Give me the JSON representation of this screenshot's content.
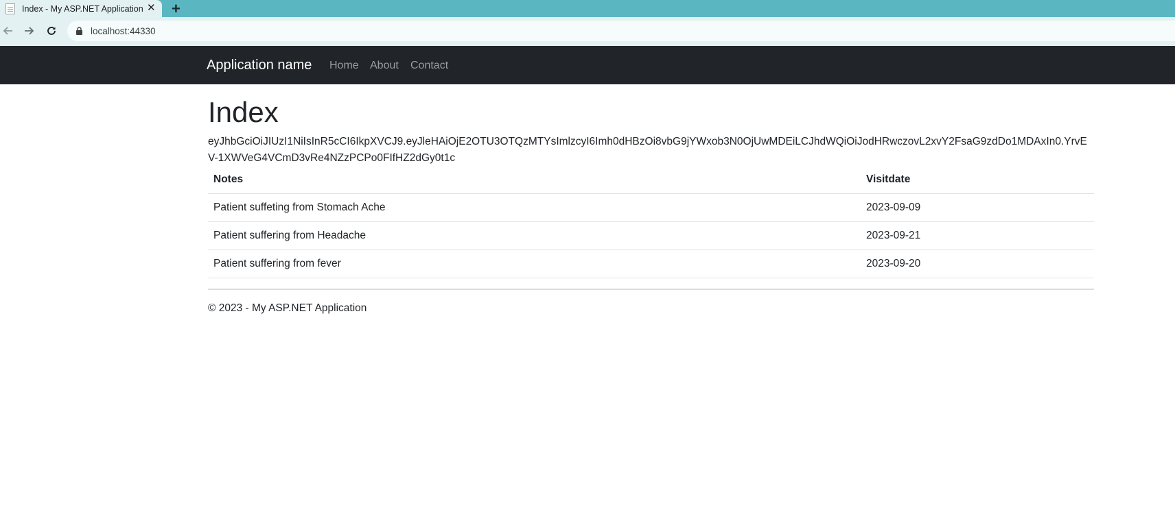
{
  "browser": {
    "tab_title": "Index - My ASP.NET Application",
    "tab_close": "✕",
    "new_tab": "+",
    "url": "localhost:44330"
  },
  "navbar": {
    "brand": "Application name",
    "links": [
      "Home",
      "About",
      "Contact"
    ]
  },
  "main": {
    "title": "Index",
    "token": "eyJhbGciOiJIUzI1NiIsInR5cCI6IkpXVCJ9.eyJleHAiOjE2OTU3OTQzMTYsImlzcyI6Imh0dHBzOi8vbG9jYWxob3N0OjUwMDEiLCJhdWQiOiJodHRwczovL2xvY2FsaG9zdDo1MDAxIn0.YrvEV-1XWVeG4VCmD3vRe4NZzPCPo0FIfHZ2dGy0t1c",
    "table": {
      "headers": [
        "Notes",
        "Visitdate"
      ],
      "rows": [
        [
          "Patient suffeting from Stomach Ache",
          "2023-09-09"
        ],
        [
          "Patient suffering from Headache",
          "2023-09-21"
        ],
        [
          "Patient suffering from fever",
          "2023-09-20"
        ]
      ]
    }
  },
  "footer": {
    "text": "© 2023 - My ASP.NET Application"
  },
  "colors": {
    "tabstrip": "#5ab7c1",
    "toolbar": "#e4f1f3",
    "navbar": "#212529",
    "nav_link": "#9a9da0"
  },
  "icons": [
    "page-favicon-icon",
    "close-icon",
    "plus-icon",
    "back-arrow-icon",
    "forward-arrow-icon",
    "reload-icon",
    "lock-icon"
  ]
}
